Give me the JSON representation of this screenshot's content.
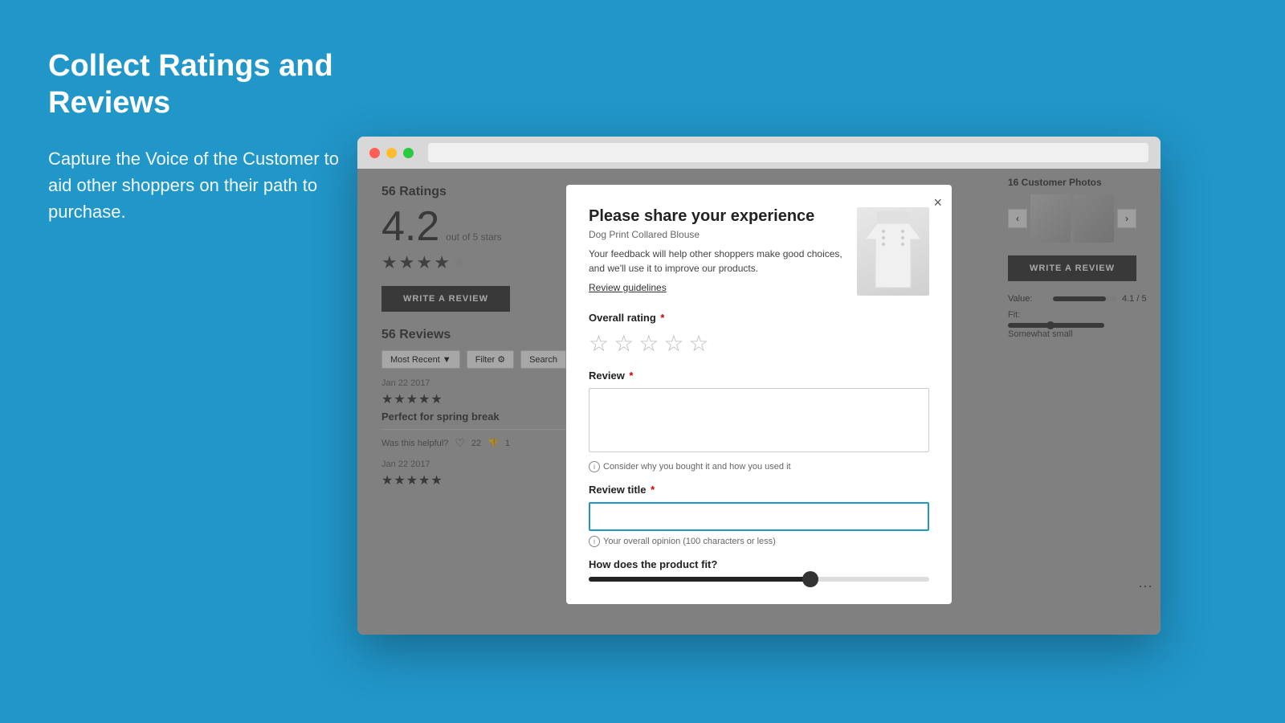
{
  "page": {
    "background_color": "#2196C9",
    "title": "Collect Ratings and Reviews",
    "subtitle": "Capture the Voice of the Customer to aid other shoppers on their path to purchase."
  },
  "browser": {
    "url_placeholder": ""
  },
  "ratings_section": {
    "title": "56 Ratings",
    "score": "4.2",
    "out_of": "out of 5 stars",
    "write_review_label": "WRITE A REVIEW",
    "reviews_title": "56 Reviews",
    "filter_label": "Most Recent ▼",
    "filter2_label": "Filter ⚙",
    "search_label": "Search"
  },
  "reviews": [
    {
      "date": "Jan 22 2017",
      "headline": "Perfect for spring break",
      "helpful_text": "Was this helpful?",
      "likes": "22",
      "dislikes": "1"
    },
    {
      "date": "Jan 22 2017",
      "headline": ""
    }
  ],
  "right_panel": {
    "photos_title": "16 Customer Photos",
    "write_review_label": "WRITE A REVIEW",
    "value_label": "Value:",
    "value_score": "4.1 / 5",
    "fit_label": "Fit:",
    "fit_text": "Somewhat small"
  },
  "modal": {
    "title": "Please share your experience",
    "product_name": "Dog Print Collared Blouse",
    "description": "Your feedback will help other shoppers make good choices, and we'll use it to improve our products.",
    "guidelines_link": "Review guidelines",
    "overall_rating_label": "Overall rating",
    "review_label": "Review",
    "review_hint": "Consider why you bought it and how you used it",
    "review_title_label": "Review title",
    "review_title_hint": "Your overall opinion (100 characters or less)",
    "product_fit_label": "How does the product fit?",
    "close_label": "×",
    "required_marker": "*"
  }
}
